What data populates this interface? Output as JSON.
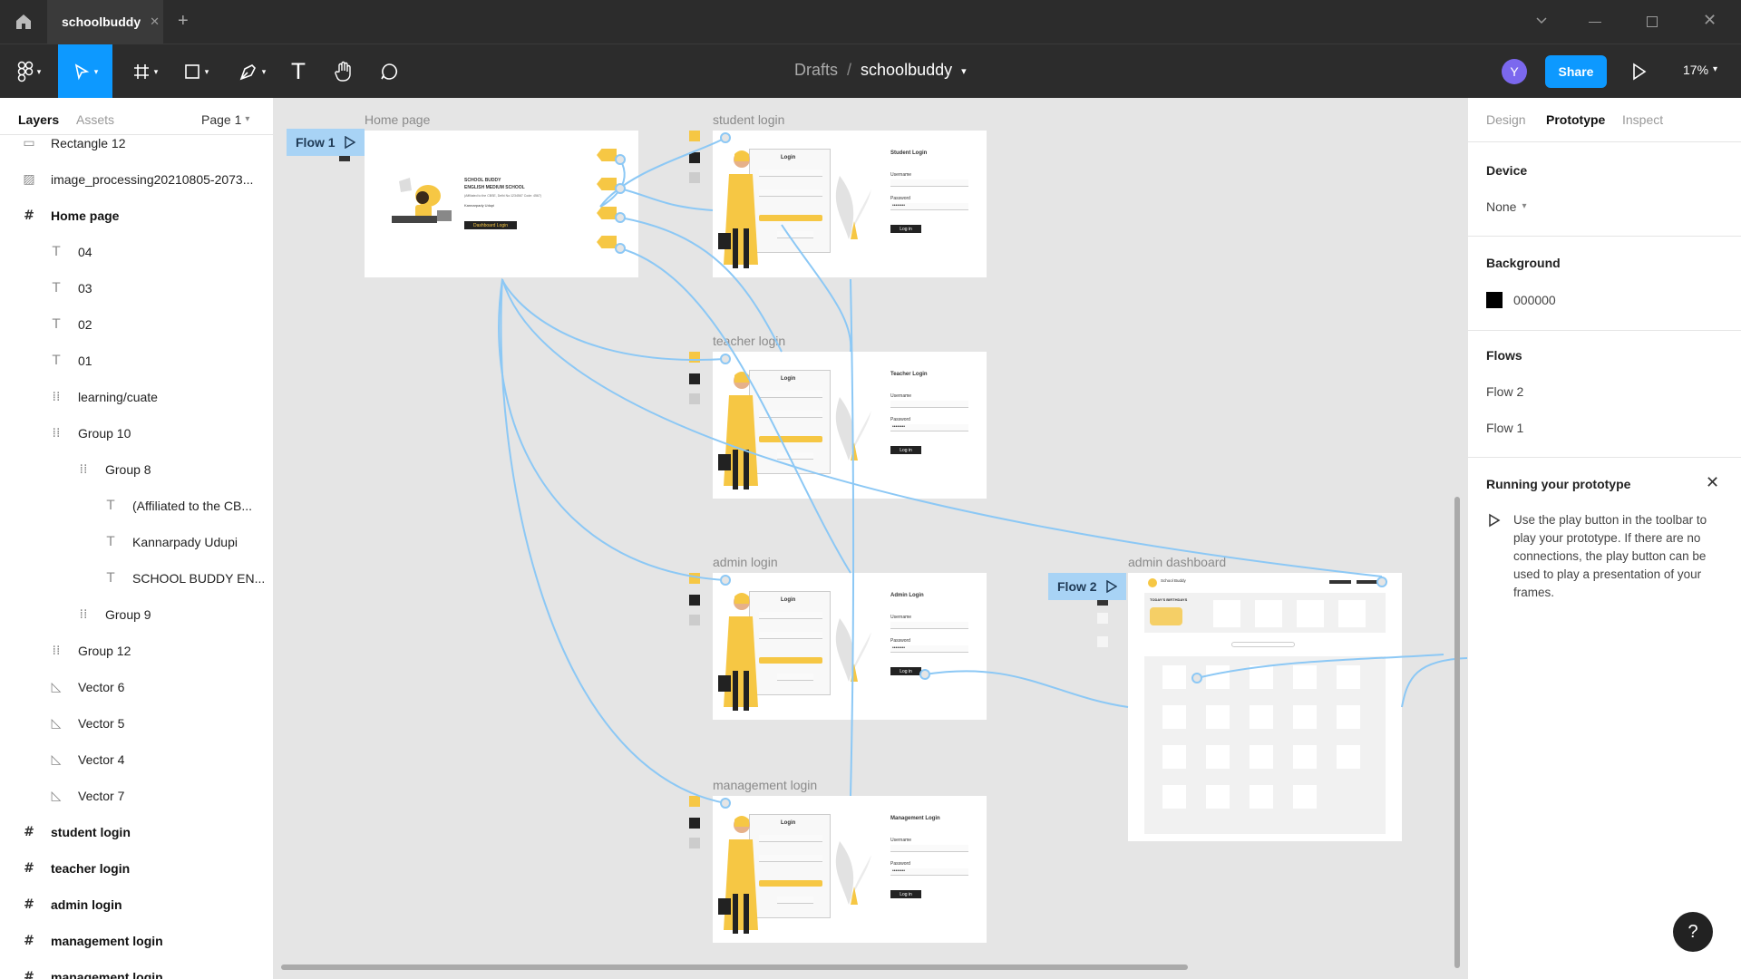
{
  "tabbar": {
    "file_tab": "schoolbuddy"
  },
  "toolbar": {
    "breadcrumb_root": "Drafts",
    "breadcrumb_sep": "/",
    "file_name": "schoolbuddy",
    "avatar_initial": "Y",
    "share_label": "Share",
    "zoom": "17%"
  },
  "left": {
    "tab_layers": "Layers",
    "tab_assets": "Assets",
    "page_select": "Page 1",
    "layers": [
      {
        "label": "Rectangle 12"
      },
      {
        "label": "image_processing20210805-2073..."
      },
      {
        "label": "Home page"
      },
      {
        "label": "04"
      },
      {
        "label": "03"
      },
      {
        "label": "02"
      },
      {
        "label": "01"
      },
      {
        "label": "learning/cuate"
      },
      {
        "label": "Group 10"
      },
      {
        "label": "Group 8"
      },
      {
        "label": "(Affiliated to the CB..."
      },
      {
        "label": "Kannarpady Udupi"
      },
      {
        "label": "SCHOOL BUDDY EN..."
      },
      {
        "label": "Group 9"
      },
      {
        "label": "Group 12"
      },
      {
        "label": "Vector 6"
      },
      {
        "label": "Vector 5"
      },
      {
        "label": "Vector 4"
      },
      {
        "label": "Vector 7"
      },
      {
        "label": "student login"
      },
      {
        "label": "teacher login"
      },
      {
        "label": "admin login"
      },
      {
        "label": "management login"
      },
      {
        "label": "management login"
      }
    ]
  },
  "canvas": {
    "frames": {
      "home": "Home page",
      "student": "student login",
      "teacher": "teacher login",
      "admin": "admin login",
      "management": "management login",
      "admin_dash": "admin dashboard"
    },
    "flow1": "Flow 1",
    "flow2": "Flow 2",
    "home_content": {
      "title1": "SCHOOL BUDDY",
      "title2": "ENGLISH MEDIUM SCHOOL",
      "affiliation": "(Affiliated to the CBSE, Delhi No:1234567 Code: 4567)",
      "place": "Kannarpady Udupi",
      "button": "Dashboard Login"
    },
    "login_card_title": "Login",
    "student_form_title": "Student Login",
    "teacher_form_title": "Teacher Login",
    "admin_form_title": "Admin Login",
    "management_form_title": "Management Login",
    "username_label": "Username",
    "password_label": "Password",
    "password_mask": "••••••••",
    "login_button": "Log in",
    "dash": {
      "brand": "School Buddy",
      "birthdays": "TODAY'S BIRTHDAYS"
    }
  },
  "right": {
    "tab_design": "Design",
    "tab_prototype": "Prototype",
    "tab_inspect": "Inspect",
    "device_title": "Device",
    "device_value": "None",
    "background_title": "Background",
    "background_value": "000000",
    "flows_title": "Flows",
    "flow_a": "Flow 2",
    "flow_b": "Flow 1",
    "running_title": "Running your prototype",
    "running_body": "Use the play button in the toolbar to play your prototype. If there are no connections, the play button can be used to play a presentation of your frames."
  },
  "colors": {
    "accent": "#0d99ff",
    "flow_blue": "#a8d3f5",
    "connector": "#8cc8f5",
    "yellow": "#f6c744"
  }
}
